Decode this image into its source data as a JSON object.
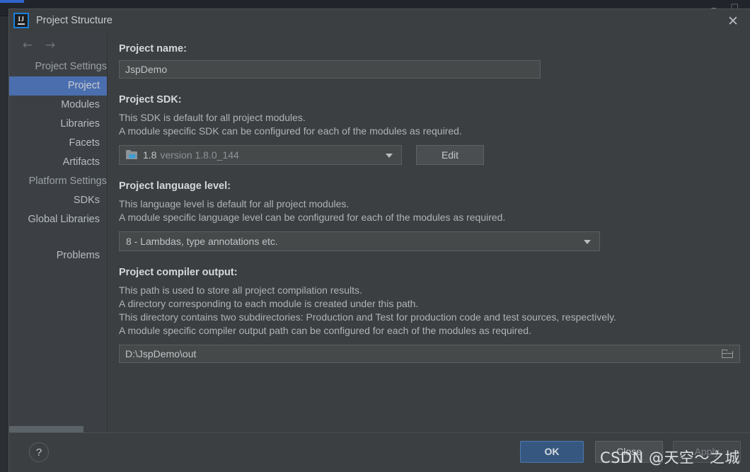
{
  "background_window": {
    "minimize_icon": "minimize-icon",
    "restore_icon": "restore-icon"
  },
  "dialog": {
    "app_icon_text": "IJ",
    "title": "Project Structure",
    "close_label": "✕"
  },
  "sidebar": {
    "back_arrow": "←",
    "forward_arrow": "→",
    "items": [
      {
        "label": "Project Settings",
        "type": "group",
        "selected": false
      },
      {
        "label": "Project",
        "type": "item",
        "selected": true
      },
      {
        "label": "Modules",
        "type": "item",
        "selected": false
      },
      {
        "label": "Libraries",
        "type": "item",
        "selected": false
      },
      {
        "label": "Facets",
        "type": "item",
        "selected": false
      },
      {
        "label": "Artifacts",
        "type": "item",
        "selected": false
      },
      {
        "label": "Platform Settings",
        "type": "group",
        "selected": false
      },
      {
        "label": "SDKs",
        "type": "item",
        "selected": false
      },
      {
        "label": "Global Libraries",
        "type": "item",
        "selected": false
      }
    ],
    "problems_label": "Problems",
    "selected_color": "#4b6eaf"
  },
  "project_name": {
    "heading": "Project name:",
    "value": "JspDemo"
  },
  "project_sdk": {
    "heading": "Project SDK:",
    "desc_line1": "This SDK is default for all project modules.",
    "desc_line2": "A module specific SDK can be configured for each of the modules as required.",
    "sdk_icon": "java-folder-icon",
    "sdk_name": "1.8",
    "sdk_version": "version 1.8.0_144",
    "dropdown_icon": "chevron-down-icon",
    "edit_label": "Edit"
  },
  "language_level": {
    "heading": "Project language level:",
    "desc_line1": "This language level is default for all project modules.",
    "desc_line2": "A module specific language level can be configured for each of the modules as required.",
    "value": "8 - Lambdas, type annotations etc.",
    "dropdown_icon": "chevron-down-icon"
  },
  "compiler_output": {
    "heading": "Project compiler output:",
    "desc_line1": "This path is used to store all project compilation results.",
    "desc_line2": "A directory corresponding to each module is created under this path.",
    "desc_line3": "This directory contains two subdirectories: Production and Test for production code and test sources, respectively.",
    "desc_line4": "A module specific compiler output path can be configured for each of the modules as required.",
    "value": "D:\\JspDemo\\out",
    "browse_icon": "folder-browse-icon"
  },
  "footer": {
    "help_label": "?",
    "ok_label": "OK",
    "close_label": "Close",
    "apply_label": "Apply",
    "ok_color": "#365880"
  },
  "watermark": {
    "text": "CSDN @天空～之城"
  }
}
